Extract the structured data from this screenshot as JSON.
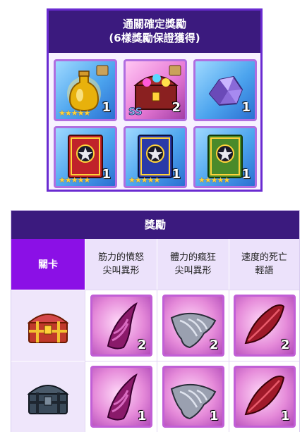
{
  "guaranteed": {
    "title_line1": "通關確定獎勵",
    "title_line2": "(6樣獎勵保證獲得)",
    "items": [
      {
        "icon": "golden-potion-icon",
        "qty": "1",
        "stars": "★★★★★"
      },
      {
        "icon": "treasure-chest-icon",
        "qty": "2",
        "stars": "",
        "badge": "SS"
      },
      {
        "icon": "purple-crystal-icon",
        "qty": "1",
        "stars": ""
      },
      {
        "icon": "red-spellbook-icon",
        "qty": "1",
        "stars": "★★★★★"
      },
      {
        "icon": "blue-spellbook-icon",
        "qty": "1",
        "stars": "★★★★★"
      },
      {
        "icon": "green-spellbook-icon",
        "qty": "1",
        "stars": "★★★★★"
      }
    ]
  },
  "rewards_table": {
    "title": "獎勵",
    "stage_header": "關卡",
    "columns": [
      {
        "line1": "筋力的憤怒",
        "line2": "尖叫異形"
      },
      {
        "line1": "體力的瘋狂",
        "line2": "尖叫異形"
      },
      {
        "line1": "速度的死亡",
        "line2": "輕語"
      }
    ],
    "rows": [
      {
        "stage_icon": "gold-chest-icon",
        "qtys": [
          "2",
          "2",
          "2"
        ]
      },
      {
        "stage_icon": "iron-chest-icon",
        "qtys": [
          "1",
          "1",
          "1"
        ]
      }
    ],
    "material_icons": [
      "purple-horn-icon",
      "silver-wing-icon",
      "red-feather-icon"
    ]
  },
  "colors": {
    "header_bg": "#3b1a7e",
    "stage_header_bg": "#8b10e6",
    "tile_border": "#b06ee0",
    "star": "#ffd23a"
  }
}
